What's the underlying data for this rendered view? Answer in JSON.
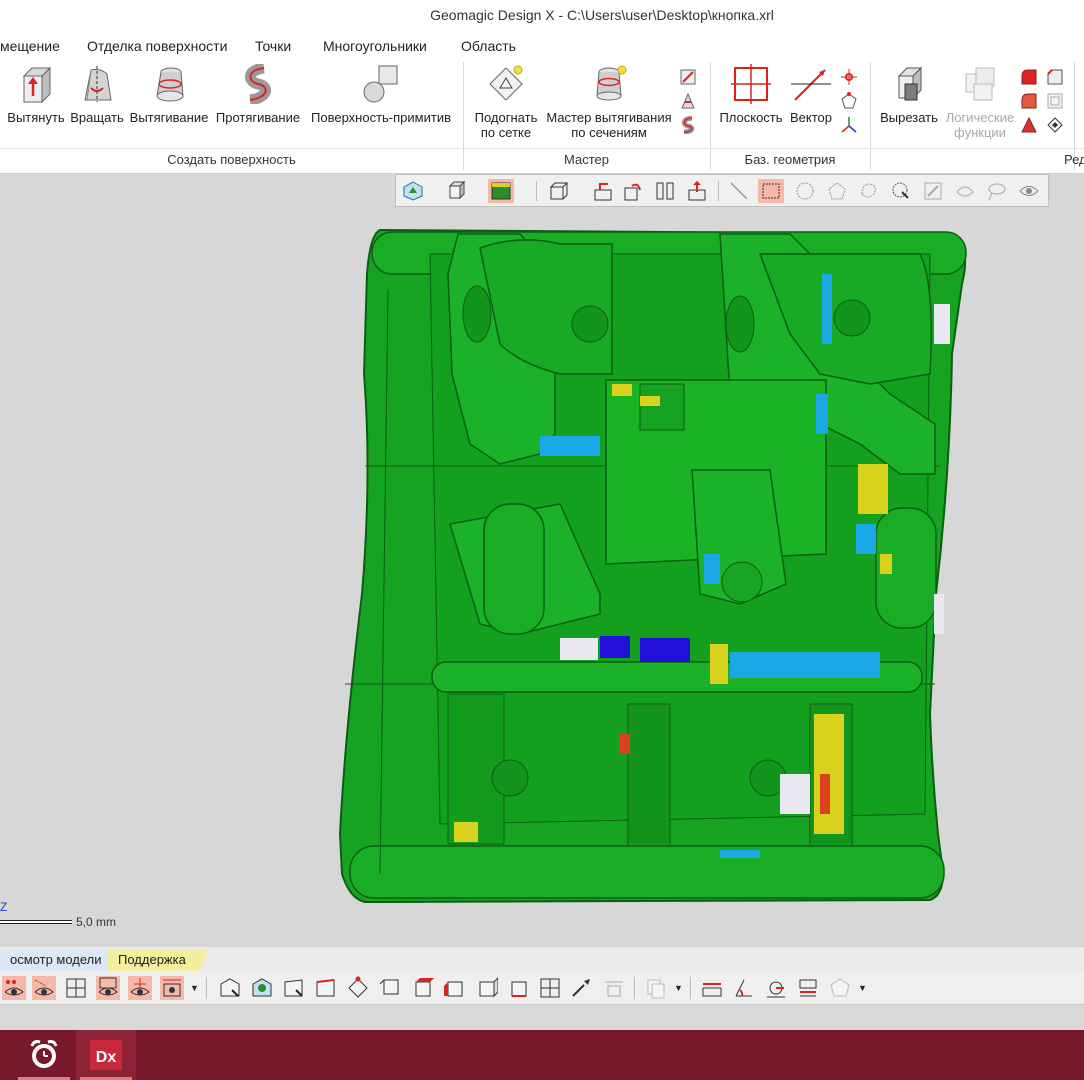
{
  "window": {
    "title": "Geomagic Design X - C:\\Users\\user\\Desktop\\кнопка.xrl"
  },
  "menu": [
    {
      "label": "мещение"
    },
    {
      "label": "Отделка поверхности"
    },
    {
      "label": "Точки"
    },
    {
      "label": "Многоугольники"
    },
    {
      "label": "Область"
    }
  ],
  "ribbon": {
    "groups": [
      {
        "label": "Создать поверхность"
      },
      {
        "label": "Мастер"
      },
      {
        "label": "Баз. геометрия"
      },
      {
        "label": "Ред"
      }
    ],
    "buttons": {
      "extrude": "Вытянуть",
      "revolve": "Вращать",
      "loft": "Вытягивание",
      "sweep": "Протягивание",
      "primitive": "Поверхность-примитив",
      "fit_mesh_1": "Подогнать",
      "fit_mesh_2": "по сетке",
      "loft_wizard_1": "Мастер вытягивания",
      "loft_wizard_2": "по сечениям",
      "plane": "Плоскость",
      "vector": "Вектор",
      "cut": "Вырезать",
      "boolean_1": "Логические",
      "boolean_2": "функции"
    }
  },
  "viewport": {
    "scale_label": "5,0 mm",
    "axis_label": "Z",
    "model_colors": {
      "main": "#16a322",
      "edge": "#0b5e12",
      "cyan": "#1aa8e6",
      "yellow": "#d8d21c",
      "blue": "#2010d8",
      "white": "#e8e8f0",
      "red": "#e04020"
    }
  },
  "bottom": {
    "tab_view": "осмотр модели",
    "tab_support": "Поддержка"
  },
  "taskbar": {
    "apps": [
      {
        "name": "alarm-clock-app"
      },
      {
        "name": "Dx"
      }
    ]
  }
}
